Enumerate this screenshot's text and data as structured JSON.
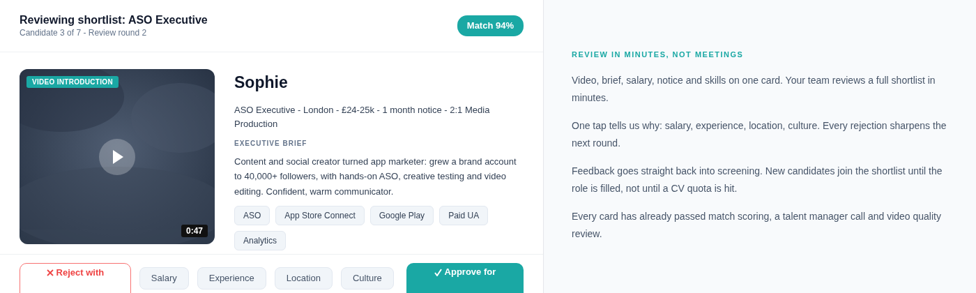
{
  "header": {
    "title": "Reviewing shortlist: ASO Executive",
    "subtitle": "Candidate 3 of 7 - Review round 2",
    "match_badge": "Match 94%"
  },
  "video": {
    "kind": "picture",
    "badge": "VIDEO INTRODUCTION",
    "duration": "0:47"
  },
  "candidate": {
    "name": "Sophie",
    "summary": "ASO Executive - London - £24-25k - 1 month notice - 2:1 Media Production",
    "brief_label": "EXECUTIVE BRIEF",
    "brief": "Content and social creator turned app marketer: grew a brand account to 40,000+ followers, with hands-on ASO, creative testing and video editing. Confident, warm communicator.",
    "skills": [
      "ASO",
      "App Store Connect",
      "Google Play",
      "Paid UA",
      "Analytics"
    ]
  },
  "actions": {
    "reject": "Reject with",
    "reasons": [
      "Salary",
      "Experience",
      "Location",
      "Culture"
    ],
    "approve": "Approve for"
  },
  "aside": {
    "heading": "REVIEW IN MINUTES, NOT MEETINGS",
    "paragraphs": [
      "Video, brief, salary, notice and skills on one card. Your team reviews a full shortlist in minutes.",
      "One tap tells us why: salary, experience, location, culture. Every rejection sharpens the next round.",
      "Feedback goes straight back into screening. New candidates join the shortlist until the role is filled, not until a CV quota is hit.",
      "Every card has already passed match scoring, a talent manager call and video quality review."
    ]
  }
}
